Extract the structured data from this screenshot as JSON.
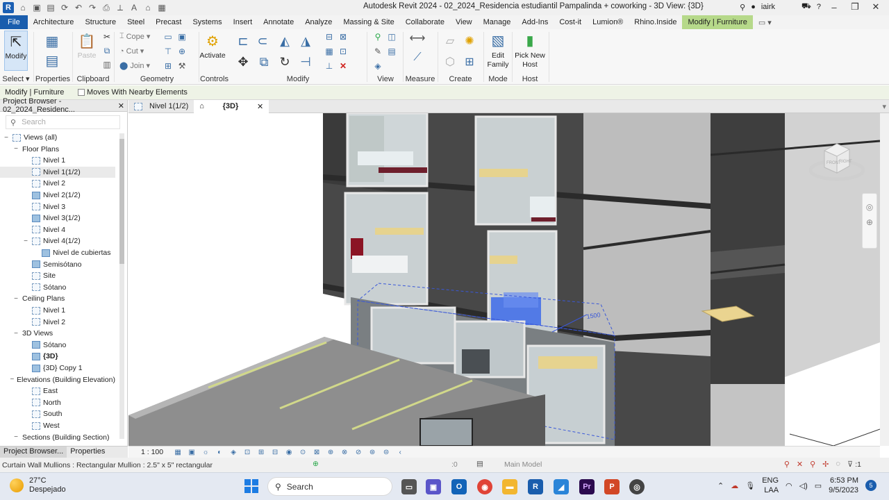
{
  "app": {
    "logo_letter": "R",
    "title": "Autodesk Revit 2024 - 02_2024_Residencia estudiantil Pampalinda + coworking - 3D View: {3D}",
    "user": "iairk",
    "help": "?"
  },
  "tabs": [
    "Architecture",
    "Structure",
    "Steel",
    "Precast",
    "Systems",
    "Insert",
    "Annotate",
    "Analyze",
    "Massing & Site",
    "Collaborate",
    "View",
    "Manage",
    "Add-Ins",
    "Cost-it",
    "Lumion®",
    "Rhino.Inside"
  ],
  "file_tab": "File",
  "active_tab": "Modify | Furniture",
  "ribbon": {
    "modify_label": "Modify",
    "select_label": "Select",
    "properties_label": "Properties",
    "clipboard_label": "Clipboard",
    "cope_label": "Cope",
    "cut_label": "Cut",
    "join_label": "Join",
    "geometry_label": "Geometry",
    "activate_label": "Activate",
    "controls_label": "Controls",
    "modify_group_label": "Modify",
    "view_label": "View",
    "measure_label": "Measure",
    "create_label": "Create",
    "edit_family_label": "Edit Family",
    "mode_label": "Mode",
    "pick_host_label": "Pick New Host",
    "host_label": "Host"
  },
  "options_bar": {
    "crumb": "Modify | Furniture",
    "checkbox_label": "Moves With Nearby Elements"
  },
  "project_browser": {
    "title": "Project Browser - 02_2024_Residenc...",
    "search_placeholder": "Search",
    "items": [
      {
        "label": "Views (all)",
        "level": 0,
        "toggle": "−",
        "icon": "views"
      },
      {
        "label": "Floor Plans",
        "level": 1,
        "toggle": "−",
        "icon": ""
      },
      {
        "label": "Nivel 1",
        "level": 2,
        "toggle": "",
        "icon": "plan"
      },
      {
        "label": "Nivel 1(1/2)",
        "level": 2,
        "toggle": "",
        "icon": "plan",
        "selected": true
      },
      {
        "label": "Nivel 2",
        "level": 2,
        "toggle": "",
        "icon": "plan"
      },
      {
        "label": "Nivel 2(1/2)",
        "level": 2,
        "toggle": "",
        "icon": "plan-filled"
      },
      {
        "label": "Nivel 3",
        "level": 2,
        "toggle": "",
        "icon": "plan"
      },
      {
        "label": "Nivel 3(1/2)",
        "level": 2,
        "toggle": "",
        "icon": "plan-filled"
      },
      {
        "label": "Nivel 4",
        "level": 2,
        "toggle": "",
        "icon": "plan"
      },
      {
        "label": "Nivel 4(1/2)",
        "level": 2,
        "toggle": "−",
        "icon": "plan"
      },
      {
        "label": "Nivel de cubiertas",
        "level": 3,
        "toggle": "",
        "icon": "plan-filled"
      },
      {
        "label": "Semisótano",
        "level": 2,
        "toggle": "",
        "icon": "plan-filled"
      },
      {
        "label": "Site",
        "level": 2,
        "toggle": "",
        "icon": "plan"
      },
      {
        "label": "Sótano",
        "level": 2,
        "toggle": "",
        "icon": "plan"
      },
      {
        "label": "Ceiling Plans",
        "level": 1,
        "toggle": "−",
        "icon": ""
      },
      {
        "label": "Nivel 1",
        "level": 2,
        "toggle": "",
        "icon": "plan"
      },
      {
        "label": "Nivel 2",
        "level": 2,
        "toggle": "",
        "icon": "plan"
      },
      {
        "label": "3D Views",
        "level": 1,
        "toggle": "−",
        "icon": ""
      },
      {
        "label": "Sótano",
        "level": 2,
        "toggle": "",
        "icon": "plan-filled"
      },
      {
        "label": "{3D}",
        "level": 2,
        "toggle": "",
        "icon": "plan-filled",
        "bold": true
      },
      {
        "label": "{3D} Copy 1",
        "level": 2,
        "toggle": "",
        "icon": "plan-filled"
      },
      {
        "label": "Elevations (Building Elevation)",
        "level": 1,
        "toggle": "−",
        "icon": ""
      },
      {
        "label": "East",
        "level": 2,
        "toggle": "",
        "icon": "plan"
      },
      {
        "label": "North",
        "level": 2,
        "toggle": "",
        "icon": "plan"
      },
      {
        "label": "South",
        "level": 2,
        "toggle": "",
        "icon": "plan"
      },
      {
        "label": "West",
        "level": 2,
        "toggle": "",
        "icon": "plan"
      },
      {
        "label": "Sections (Building Section)",
        "level": 1,
        "toggle": "−",
        "icon": ""
      }
    ],
    "bottom_tabs": [
      "Project Browser...",
      "Properties"
    ]
  },
  "view_tabs": [
    {
      "label": "Nivel 1(1/2)",
      "current": false
    },
    {
      "label": "{3D}",
      "current": true
    }
  ],
  "canvas": {
    "dimension_text": "1500",
    "viewcube_front": "FRONT",
    "viewcube_right": "RIGHT"
  },
  "view_control_bar": {
    "scale": "1 : 100"
  },
  "status_bar": {
    "message": "Curtain Wall Mullions : Rectangular Mullion : 2.5\" x 5\" rectangular",
    "workset_count": ":0",
    "model": "Main Model",
    "filter_count": ":1"
  },
  "taskbar": {
    "temperature": "27°C",
    "weather": "Despejado",
    "search_label": "Search",
    "lang1": "ENG",
    "lang2": "LAA",
    "time": "6:53 PM",
    "date": "9/5/2023",
    "notification_count": "5"
  },
  "colors": {
    "file_tab": "#1a5dad",
    "contextual_tab": "#b6d98a",
    "selection_blue": "#2f5fe8",
    "wall_dark": "#4a4a4a",
    "wall_light": "#b8b8b8"
  }
}
